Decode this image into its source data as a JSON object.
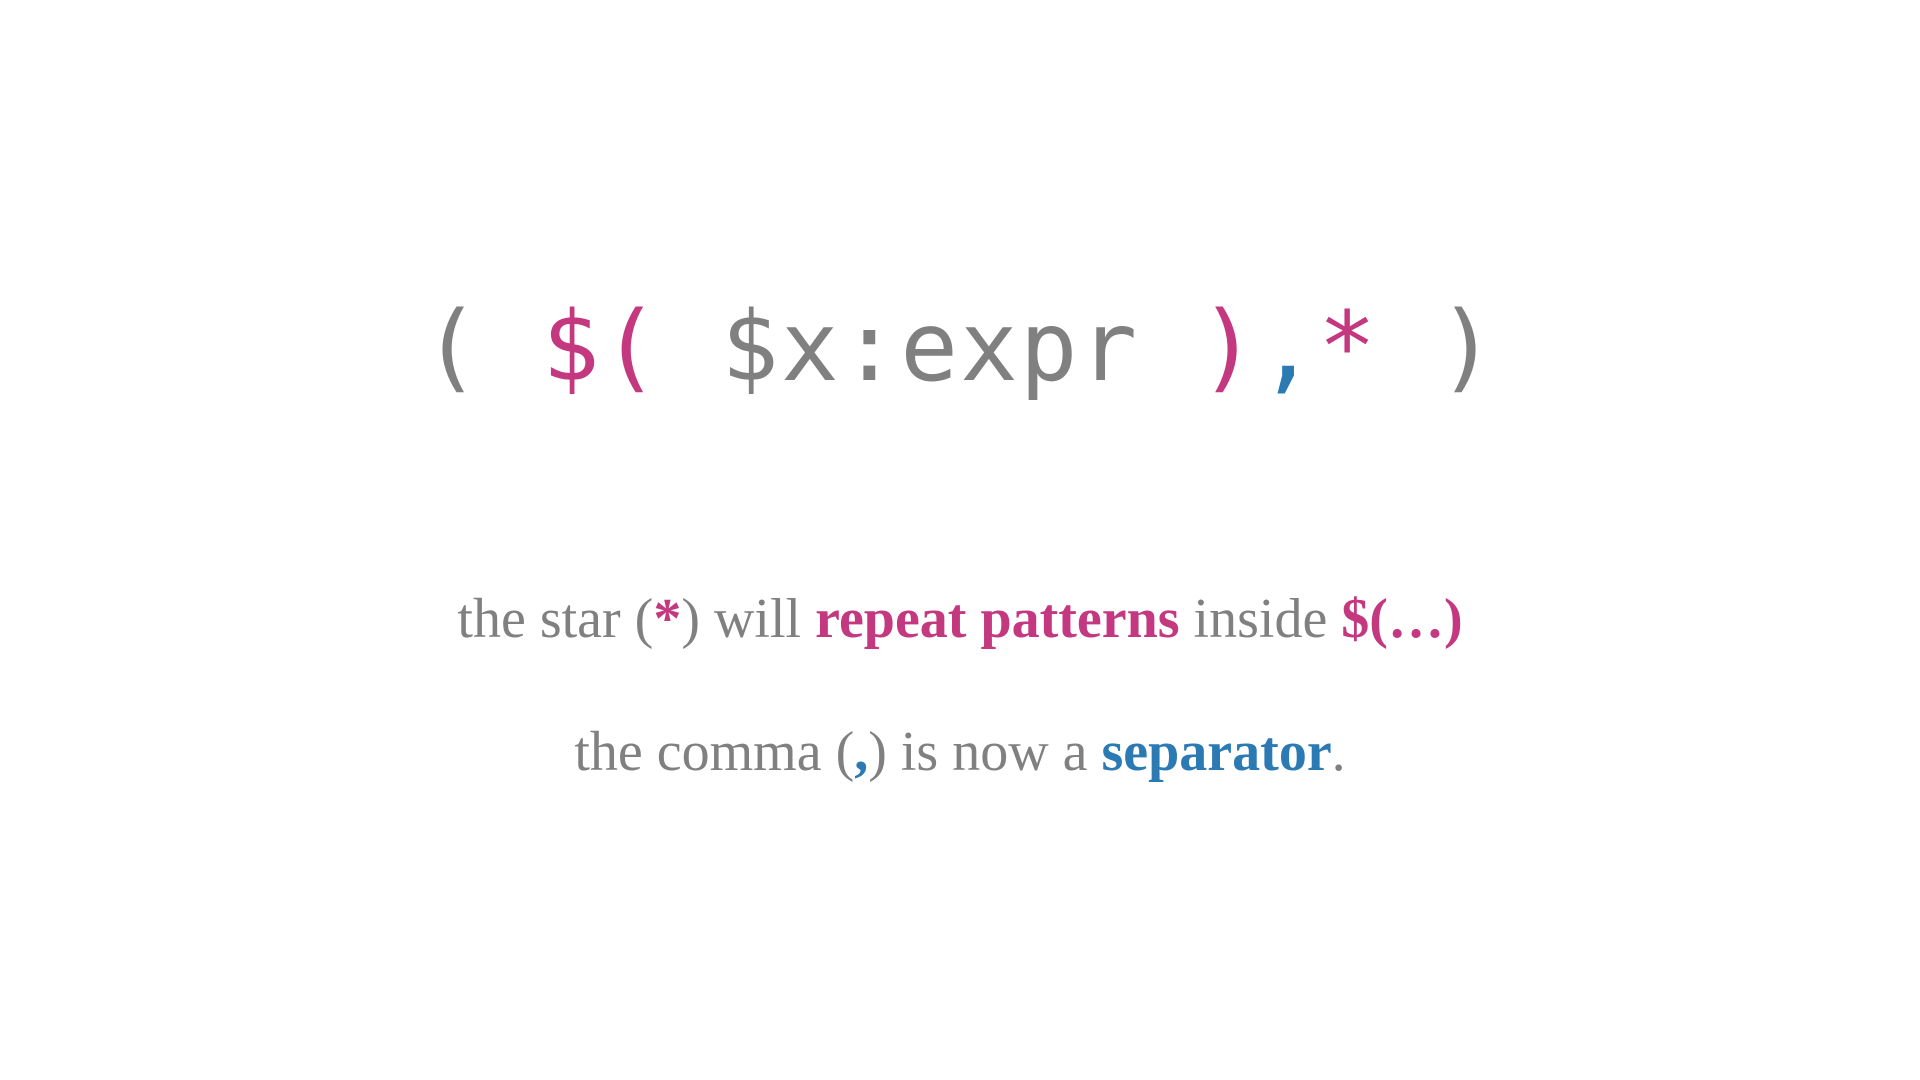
{
  "code": {
    "p1": "( ",
    "p2": "$(",
    "p3": " $x:expr ",
    "p4": ")",
    "p5": ",",
    "p6": "*",
    "p7": " )"
  },
  "line1": {
    "t1": "the star (",
    "t2": "*",
    "t3": ") will ",
    "t4": "repeat patterns",
    "t5": " inside ",
    "t6": "$(…)"
  },
  "line2": {
    "t1": "the comma (",
    "t2": ",",
    "t3": ") is now a ",
    "t4": "separator",
    "t5": "."
  }
}
